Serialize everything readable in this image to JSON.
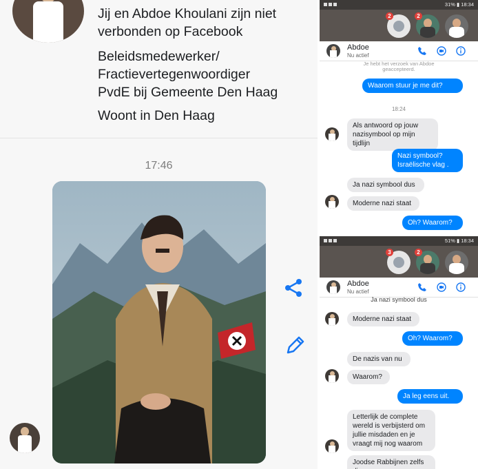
{
  "profile": {
    "not_connected": [
      "Jij en Abdoe Khoulani zijn niet",
      "verbonden op Facebook"
    ],
    "job": [
      "Beleidsmedewerker/",
      "Fractievertegenwoordiger",
      "PvdE bij Gemeente Den Haag"
    ],
    "lives": "Woont in Den Haag"
  },
  "main_chat": {
    "timestamp": "17:46",
    "photo_alt": "photo"
  },
  "top_phone": {
    "status_right": "31% ▮ 18:34",
    "badges": [
      "2",
      "2"
    ],
    "contact_name": "Abdoe",
    "contact_status": "Nu actief",
    "system_note": [
      "Je hebt het verzoek van Abdoe",
      "geaccepteerd."
    ],
    "time_separator": "18:24",
    "messages": [
      {
        "dir": "out",
        "text": "Waarom stuur je me dit?"
      },
      {
        "dir": "in",
        "text": "Als antwoord op jouw nazisymbool op mijn tijdlijn"
      },
      {
        "dir": "out",
        "text": "Nazi symbool? Israëlische vlag ."
      },
      {
        "dir": "in",
        "text": "Ja nazi symbool dus"
      },
      {
        "dir": "in",
        "text": "Moderne nazi staat"
      },
      {
        "dir": "out",
        "text": "Oh? Waarom?"
      }
    ]
  },
  "bottom_phone": {
    "status_right": "51% ▮ 18:34",
    "badges": [
      "3",
      "2"
    ],
    "contact_name": "Abdoe",
    "contact_status": "Nu actief",
    "partial_top": "Ja nazi symbool dus",
    "messages": [
      {
        "dir": "in",
        "text": "Moderne nazi staat"
      },
      {
        "dir": "out",
        "text": "Oh? Waarom?"
      },
      {
        "dir": "in",
        "text": "De nazis van nu"
      },
      {
        "dir": "in",
        "text": "Waarom?"
      },
      {
        "dir": "out",
        "text": "Ja leg eens uit."
      },
      {
        "dir": "in",
        "text": "Letterlijk de complete wereld is verbijsterd om jullie misdaden en je vraagt mij nog waarom"
      },
      {
        "dir": "in",
        "text": "Joodse Rabbijnen zelfs die"
      }
    ]
  },
  "colors": {
    "messenger_blue": "#0084ff",
    "incoming_gray": "#e9e9eb",
    "icon_blue": "#1877f2"
  }
}
